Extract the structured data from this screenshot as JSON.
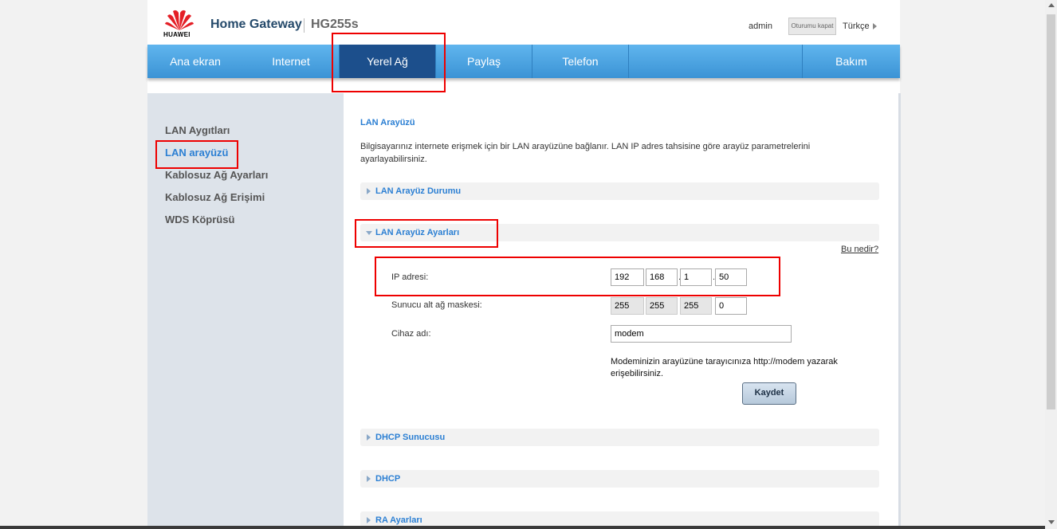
{
  "header": {
    "logo_text": "HUAWEI",
    "title": "Home Gateway",
    "model": "HG255s",
    "user": "admin",
    "logout_label": "Oturumu kapat",
    "language": "Türkçe",
    "brand_color": "#254a6b"
  },
  "nav": {
    "items": [
      {
        "label": "Ana ekran"
      },
      {
        "label": "Internet"
      },
      {
        "label": "Yerel Ağ",
        "active": true
      },
      {
        "label": "Paylaş"
      },
      {
        "label": "Telefon"
      },
      {
        "label": "Bakım"
      }
    ],
    "bar_color": "#3b93d5",
    "active_color": "#1c4f8c"
  },
  "sidebar": {
    "items": [
      {
        "label": "LAN Aygıtları"
      },
      {
        "label": "LAN arayüzü",
        "active": true
      },
      {
        "label": "Kablosuz Ağ Ayarları"
      },
      {
        "label": "Kablosuz Ağ Erişimi"
      },
      {
        "label": "WDS Köprüsü"
      }
    ]
  },
  "main": {
    "title": "LAN Arayüzü",
    "description": "Bilgisayarınız internete erişmek için bir LAN arayüzüne bağlanır. LAN IP adres tahsisine göre arayüz parametrelerini ayarlayabilirsiniz.",
    "sections": {
      "status": "LAN Arayüz Durumu",
      "settings": "LAN Arayüz Ayarları",
      "dhcp_server": "DHCP Sunucusu",
      "dhcp": "DHCP",
      "ra": "RA Ayarları"
    },
    "help_link": "Bu nedir?",
    "form": {
      "ip_label": "IP adresi:",
      "ip": [
        "192",
        "168",
        "1",
        "50"
      ],
      "mask_label": "Sunucu alt ağ maskesi:",
      "mask": [
        "255",
        "255",
        "255",
        "0"
      ],
      "device_label": "Cihaz adı:",
      "device_name": "modem",
      "hint": "Modeminizin arayüzüne tarayıcınıza http://modem yazarak erişebilirsiniz.",
      "save_label": "Kaydet"
    }
  },
  "annotation_color": "#e00000"
}
